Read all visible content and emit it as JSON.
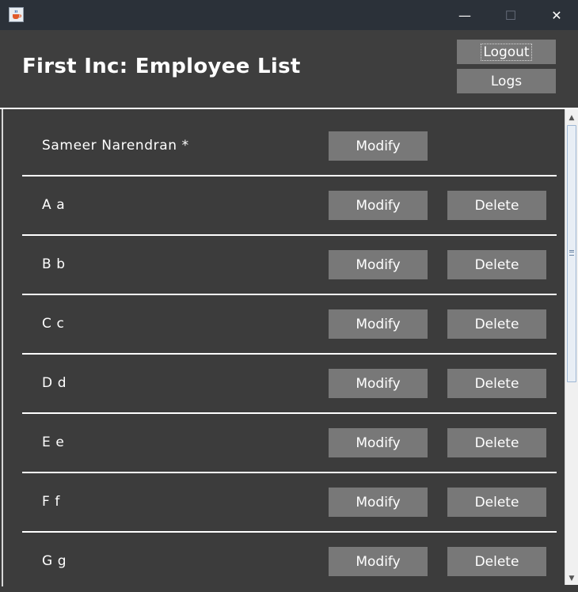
{
  "window": {
    "minimize_glyph": "—",
    "maximize_glyph": "☐",
    "close_glyph": "✕"
  },
  "header": {
    "title": "First Inc: Employee List",
    "logout_label": "Logout",
    "logs_label": "Logs"
  },
  "employees": [
    {
      "name": "Sameer Narendran *",
      "modify_label": "Modify",
      "delete_label": ""
    },
    {
      "name": "A a",
      "modify_label": "Modify",
      "delete_label": "Delete"
    },
    {
      "name": "B b",
      "modify_label": "Modify",
      "delete_label": "Delete"
    },
    {
      "name": "C c",
      "modify_label": "Modify",
      "delete_label": "Delete"
    },
    {
      "name": "D d",
      "modify_label": "Modify",
      "delete_label": "Delete"
    },
    {
      "name": "E e",
      "modify_label": "Modify",
      "delete_label": "Delete"
    },
    {
      "name": "F f",
      "modify_label": "Modify",
      "delete_label": "Delete"
    },
    {
      "name": "G g",
      "modify_label": "Modify",
      "delete_label": "Delete"
    }
  ],
  "icons": {
    "app": "java-cup-icon",
    "scroll_up": "chevron-up-icon",
    "scroll_down": "chevron-down-icon"
  },
  "colors": {
    "titlebar": "#2b3139",
    "background": "#3c3c3c",
    "button": "#787878",
    "text": "#ffffff"
  }
}
